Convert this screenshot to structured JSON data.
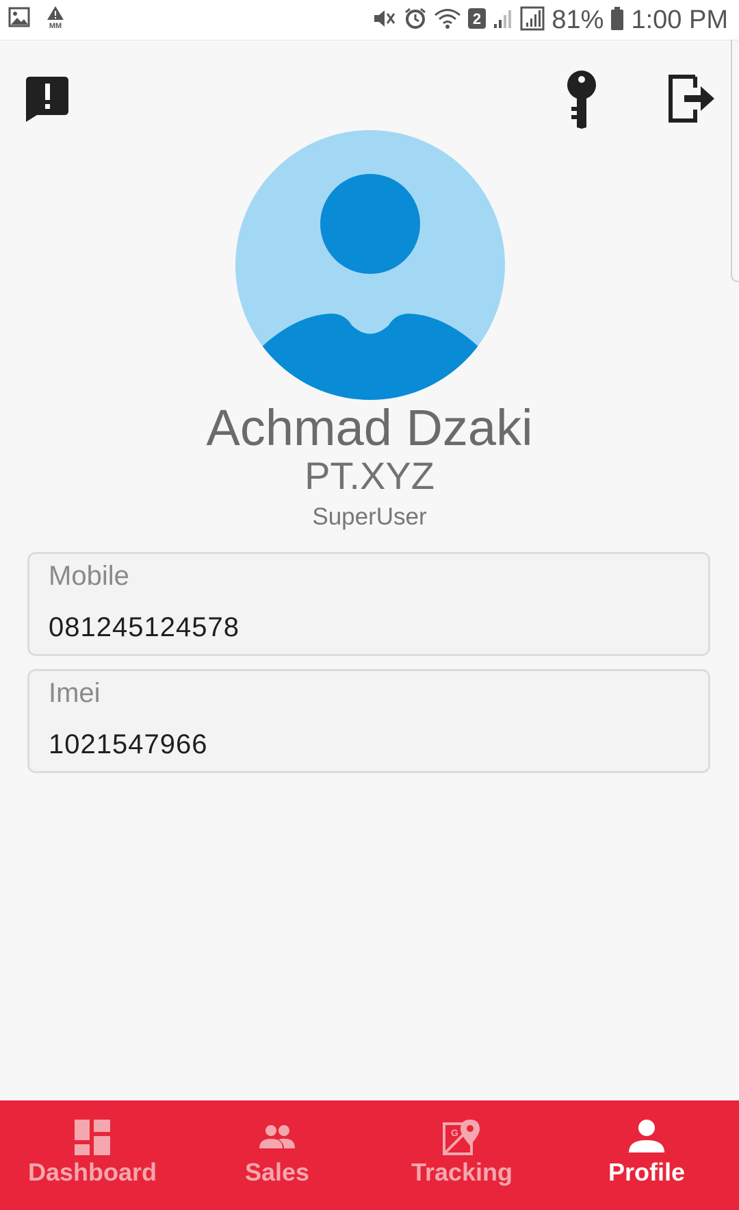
{
  "status_bar": {
    "battery_percent": "81%",
    "time": "1:00 PM",
    "sim_badge": "2",
    "left_icons": [
      "gallery-icon",
      "alert-triangle-mm-icon"
    ],
    "right_icons": [
      "mute-icon",
      "alarm-icon",
      "wifi-icon",
      "signal-icon",
      "signal-full-icon",
      "battery-icon"
    ],
    "left_badge_text": "MM"
  },
  "header": {
    "left_icon": "report-alert-icon",
    "right_icons": [
      "key-icon",
      "logout-icon"
    ]
  },
  "profile": {
    "name": "Achmad Dzaki",
    "company": "PT.XYZ",
    "role": "SuperUser",
    "avatar_colors": {
      "background": "#a3d8f4",
      "figure": "#0a8bd6"
    }
  },
  "fields": {
    "mobile": {
      "label": "Mobile",
      "value": "081245124578"
    },
    "imei": {
      "label": "Imei",
      "value": "1021547966"
    }
  },
  "bottom_nav": {
    "items": [
      {
        "label": "Dashboard",
        "icon": "dashboard-icon",
        "active": false
      },
      {
        "label": "Sales",
        "icon": "group-icon",
        "active": false
      },
      {
        "label": "Tracking",
        "icon": "map-tracking-icon",
        "active": false
      },
      {
        "label": "Profile",
        "icon": "person-icon",
        "active": true
      }
    ],
    "active_index": 3,
    "background": "#e8253b"
  }
}
